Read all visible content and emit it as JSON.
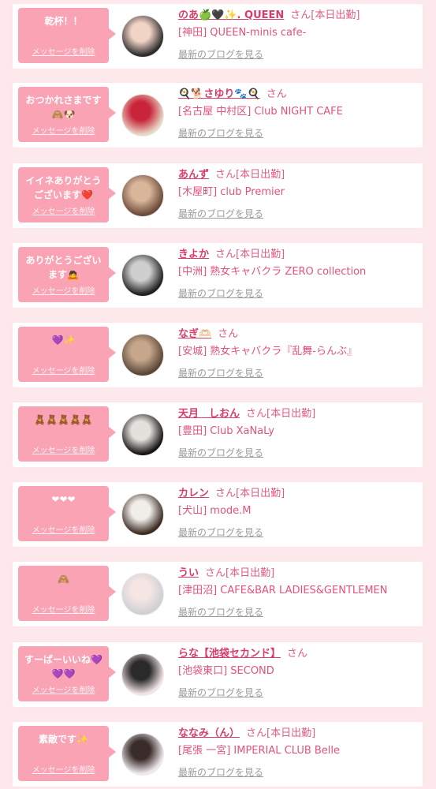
{
  "delete_label": "メッセージを削除",
  "blog_label": "最新のブログを見る",
  "cards": [
    {
      "message": "乾杯！！",
      "name": "のあ🍏🖤✨. QUEEN",
      "honorific": "さん[本日出勤]",
      "shop": "[神田] QUEEN-minis cafe-",
      "avatar_colors": [
        "#2b2b2b",
        "#f2d4c7"
      ]
    },
    {
      "message": "おつかれさまです🙈🐶",
      "name": "🍳🐕さゆり🐾🍳",
      "honorific": "さん",
      "shop": "[名古屋 中村区] Club NIGHT CAFE",
      "avatar_colors": [
        "#e8d7c5",
        "#c9243a"
      ]
    },
    {
      "message": "イイネありがとうございます❤️",
      "name": "あんず",
      "honorific": "さん[本日出勤]",
      "shop": "[木屋町] club Premier",
      "avatar_colors": [
        "#6b4a3a",
        "#d9b59a"
      ]
    },
    {
      "message": "ありがとうございます🙇",
      "name": "きよか",
      "honorific": "さん[本日出勤]",
      "shop": "[中洲] 熟女キャバクラ ZERO collection",
      "avatar_colors": [
        "#1f1f1f",
        "#cfcfcf"
      ]
    },
    {
      "message": "💜✨",
      "name": "なぎ🫶🏻",
      "honorific": "さん",
      "shop": "[安城] 熟女キャバクラ『乱舞-らんぶ』",
      "avatar_colors": [
        "#5a4636",
        "#c7a78c"
      ]
    },
    {
      "message": "🧸🧸🧸🧸🧸",
      "name": "天月　しおん",
      "honorific": "さん[本日出勤]",
      "shop": "[豊田] Club XaNaLy",
      "avatar_colors": [
        "#141414",
        "#e4e0dc"
      ]
    },
    {
      "message": "❤❤❤",
      "name": "カレン",
      "honorific": "さん[本日出勤]",
      "shop": "[犬山] mode.M",
      "avatar_colors": [
        "#3a2a22",
        "#f1ede9"
      ]
    },
    {
      "message": "🙈",
      "name": "うい",
      "honorific": "さん[本日出勤]",
      "shop": "[津田沼] CAFE&BAR LADIES&GENTLEMEN",
      "avatar_colors": [
        "#cfcfd4",
        "#f5e6e4"
      ]
    },
    {
      "message": "すーばーいいね💜💜💜",
      "name": "らな【池袋セカンド】",
      "honorific": "さん",
      "shop": "[池袋東口] SECOND",
      "avatar_colors": [
        "#f3e4e6",
        "#2a2a2a"
      ]
    },
    {
      "message": "素敵です✨",
      "name": "ななみ（ん）",
      "honorific": "さん[本日出勤]",
      "shop": "[尾張 一宮] IMPERIAL CLUB Belle",
      "avatar_colors": [
        "#efe9ec",
        "#3a2c2a"
      ]
    }
  ],
  "colors": {
    "background": "#fde8ec",
    "bubble": "#f9a3b5",
    "name": "#d93c6a",
    "shop": "#e3527a",
    "link": "#9b9b9b"
  }
}
